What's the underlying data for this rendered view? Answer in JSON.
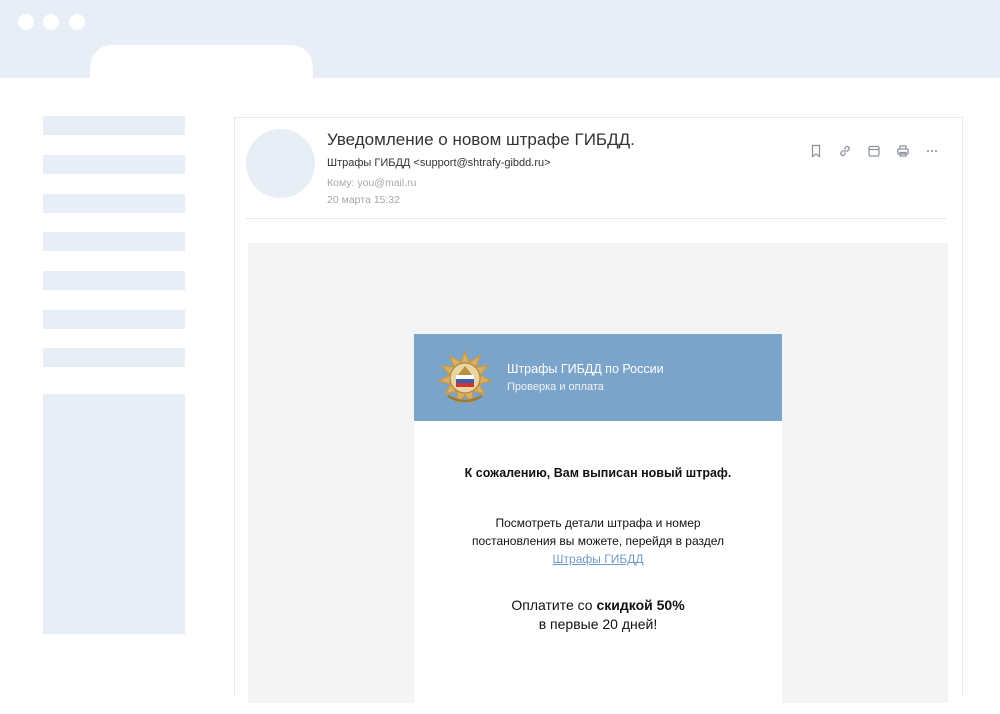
{
  "email": {
    "subject": "Уведомление о новом штрафе ГИБДД.",
    "sender": "Штрафы ГИБДД <support@shtrafy-gibdd.ru>",
    "recipient": "Кому: you@mail.ru",
    "date": "20 марта 15:32"
  },
  "toolbar": {
    "icons": [
      "bookmark-icon",
      "link-icon",
      "calendar-icon",
      "print-icon",
      "more-icon"
    ]
  },
  "letter": {
    "brand_title": "Штрафы ГИБДД по России",
    "brand_subtitle": "Проверка и оплата",
    "headline": "К сожалению, Вам выписан новый штраф.",
    "details_line1": "Посмотреть детали штрафа и номер",
    "details_line2": "постановления вы можете, перейдя в раздел",
    "details_link": "Штрафы ГИБДД",
    "promo_prefix": "Оплатите со ",
    "promo_bold": "скидкой 50%",
    "promo_line2": "в первые 20 дней!"
  },
  "colors": {
    "header_blue": "#7ba4ca",
    "link": "#6d9bc7",
    "placeholder": "#e8eef6"
  }
}
